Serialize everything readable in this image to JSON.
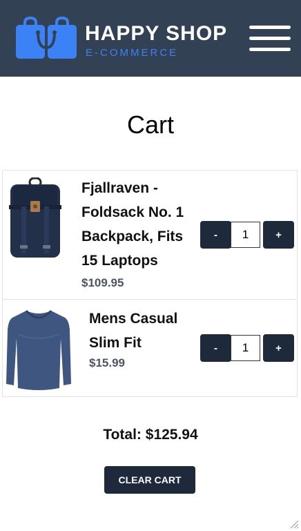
{
  "header": {
    "brand_name": "HAPPY SHOP",
    "brand_tagline": "E-COMMERCE",
    "logo_icon": "shopping-bags-icon",
    "menu_icon": "hamburger-menu-icon"
  },
  "page": {
    "title": "Cart"
  },
  "cart": {
    "items": [
      {
        "name": "Fjallraven - Foldsack No. 1 Backpack, Fits 15 Laptops",
        "price": "$109.95",
        "quantity": "1",
        "image_icon": "backpack-image",
        "decrement_label": "-",
        "increment_label": "+"
      },
      {
        "name": "Mens Casual Slim Fit",
        "price": "$15.99",
        "quantity": "1",
        "image_icon": "long-sleeve-shirt-image",
        "decrement_label": "-",
        "increment_label": "+"
      }
    ],
    "total_label": "Total: $125.94",
    "clear_label": "CLEAR CART"
  },
  "colors": {
    "header_bg": "#334155",
    "brand_accent": "#3b82f6",
    "button_bg": "#1e293b",
    "price_text": "#4b5563"
  }
}
